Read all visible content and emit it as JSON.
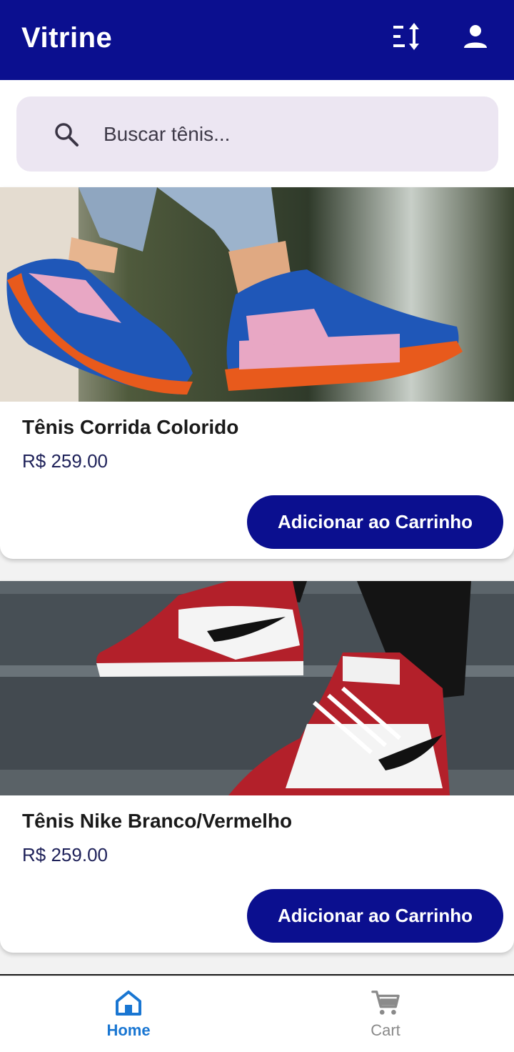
{
  "appbar": {
    "title": "Vitrine",
    "sort_icon": "sort-icon",
    "profile_icon": "person-icon"
  },
  "search": {
    "placeholder": "Buscar tênis...",
    "value": "",
    "icon": "search-icon"
  },
  "products": [
    {
      "name": "Tênis Corrida Colorido",
      "price": "R$ 259.00",
      "button_label": "Adicionar ao Carrinho"
    },
    {
      "name": "Tênis Nike Branco/Vermelho",
      "price": "R$ 259.00",
      "button_label": "Adicionar ao Carrinho"
    }
  ],
  "bottom_nav": [
    {
      "label": "Home",
      "icon": "home-icon",
      "active": true
    },
    {
      "label": "Cart",
      "icon": "cart-icon",
      "active": false
    }
  ],
  "colors": {
    "primary": "#0b0f8f",
    "active_nav": "#1976d2",
    "search_bg": "#ece6f2"
  }
}
